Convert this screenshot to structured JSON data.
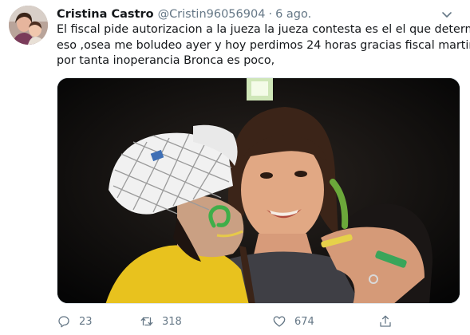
{
  "tweet": {
    "display_name": "Cristina Castro",
    "handle": "@Cristin96056904",
    "separator": "·",
    "time": "6 ago.",
    "text_lines": [
      "El fiscal pide autorizacion  a la jueza la jueza contesta es el el que determina",
      "eso ,osea me boludeo ayer y hoy perdimos 24 horas gracias fiscal martinez",
      "por tanta inoperancia Bronca es poco,"
    ]
  },
  "actions": {
    "reply": {
      "icon": "reply-icon",
      "count": "23"
    },
    "retweet": {
      "icon": "retweet-icon",
      "count": "318"
    },
    "like": {
      "icon": "heart-icon",
      "count": "674"
    },
    "share": {
      "icon": "share-icon"
    }
  },
  "colors": {
    "text": "#14171a",
    "secondary": "#657786",
    "border": "#e1e8ed"
  }
}
